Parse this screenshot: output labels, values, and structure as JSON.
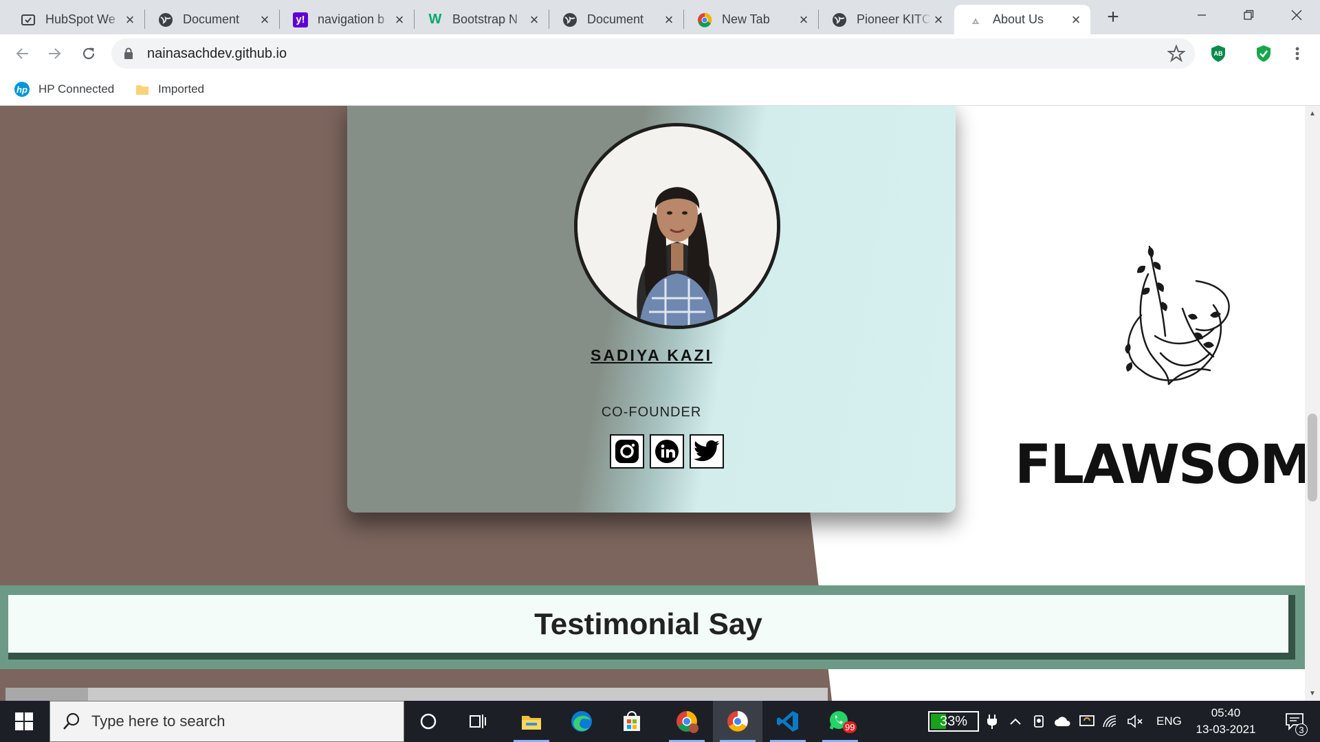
{
  "browser": {
    "tabs": [
      {
        "title": "HubSpot We",
        "icon": "hubspot-icon"
      },
      {
        "title": "Document",
        "icon": "globe-icon"
      },
      {
        "title": "navigation b",
        "icon": "yahoo-icon"
      },
      {
        "title": "Bootstrap N",
        "icon": "w3schools-icon"
      },
      {
        "title": "Document",
        "icon": "globe-icon"
      },
      {
        "title": "New Tab",
        "icon": "chrome-icon"
      },
      {
        "title": "Pioneer KITC",
        "icon": "globe-icon"
      },
      {
        "title": "About Us",
        "icon": "page-loading-icon",
        "active": true
      }
    ],
    "url": "nainasachdev.github.io",
    "bookmarks": [
      {
        "label": "HP Connected",
        "icon": "hp-icon"
      },
      {
        "label": "Imported",
        "icon": "folder-icon"
      }
    ],
    "extensions": [
      {
        "name": "adblock-extension-icon",
        "label": "AB"
      },
      {
        "name": "shield-extension-icon"
      }
    ]
  },
  "page": {
    "member": {
      "name": "SADIYA KAZI",
      "role": "CO-FOUNDER",
      "socials": [
        "instagram-icon",
        "linkedin-icon",
        "twitter-icon"
      ]
    },
    "brand_text": "FLAWSOMI",
    "testimonial_heading": "Testimonial Say",
    "colors": {
      "brown_bg": "#7b655d",
      "card_left": "#858f87",
      "card_right": "#d6f0ef",
      "band_green": "#6c9a86",
      "band_dark": "#355445"
    }
  },
  "taskbar": {
    "search_placeholder": "Type here to search",
    "pinned": [
      "cortana-icon",
      "task-view-icon",
      "file-explorer-icon",
      "edge-icon",
      "store-icon",
      "chrome-profile-icon",
      "chrome-icon",
      "vscode-icon",
      "whatsapp-icon"
    ],
    "whatsapp_badge": "99",
    "battery_level": 0.33,
    "battery_text": "33%",
    "language": "ENG",
    "time": "05:40",
    "date": "13-03-2021",
    "notification_count": "3"
  }
}
